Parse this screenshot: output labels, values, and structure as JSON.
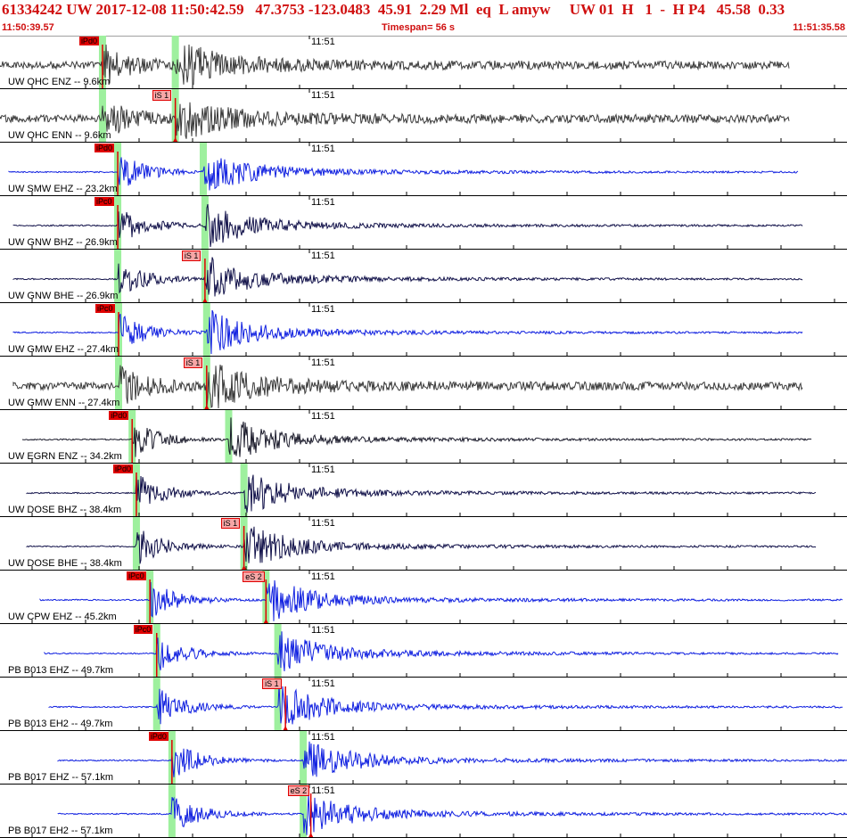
{
  "header": {
    "summary": "61334242 UW 2017-12-08 11:50:42.59   47.3753 -123.0483  45.91  2.29 Ml  eq  L amyw     UW 01  H   1  -  H P4   45.58  0.33",
    "start_time": "11:50:39.57",
    "timespan": "Timespan=  56 s",
    "end_time": "11:51:35.58"
  },
  "minute_mark": "11:51",
  "colors": {
    "header_text": "#d01010",
    "highlight": "#9ef09e",
    "pick": "#e00000",
    "pick_s_fill": "#f6a6a6"
  },
  "channels": [
    {
      "label": "UW OHC ENZ -- 9.6km",
      "color": "#3a3a3a",
      "hl_p": 0.121,
      "hl_s": 0.207,
      "picks": [
        {
          "type": "p",
          "label": "iPd0",
          "t": 0.121
        }
      ]
    },
    {
      "label": "UW OHC ENN -- 9.6km",
      "color": "#3a3a3a",
      "hl_p": 0.121,
      "hl_s": 0.207,
      "picks": [
        {
          "type": "s",
          "label": "iS 1",
          "t": 0.207
        }
      ]
    },
    {
      "label": "UW SMW EHZ -- 23.2km",
      "color": "#1020e0",
      "hl_p": 0.139,
      "hl_s": 0.24,
      "picks": [
        {
          "type": "p",
          "label": "iPd0",
          "t": 0.139
        }
      ]
    },
    {
      "label": "UW GNW BHZ -- 26.9km",
      "color": "#12124a",
      "hl_p": 0.139,
      "hl_s": 0.242,
      "picks": [
        {
          "type": "p",
          "label": "iPc0",
          "t": 0.139
        }
      ]
    },
    {
      "label": "UW GNW BHE -- 26.9km",
      "color": "#12124a",
      "hl_p": 0.139,
      "hl_s": 0.242,
      "picks": [
        {
          "type": "s",
          "label": "iS 1",
          "t": 0.242
        }
      ]
    },
    {
      "label": "UW GMW EHZ -- 27.4km",
      "color": "#1020e0",
      "hl_p": 0.14,
      "hl_s": 0.244,
      "picks": [
        {
          "type": "p",
          "label": "iPc0",
          "t": 0.14
        }
      ]
    },
    {
      "label": "UW GMW ENN -- 27.4km",
      "color": "#3a3a3a",
      "hl_p": 0.14,
      "hl_s": 0.244,
      "picks": [
        {
          "type": "s",
          "label": "iS 1",
          "t": 0.244
        }
      ]
    },
    {
      "label": "UW EGRN ENZ -- 34.2km",
      "color": "#1c1c2c",
      "hl_p": 0.156,
      "hl_s": 0.27,
      "picks": [
        {
          "type": "p",
          "label": "iPd0",
          "t": 0.156
        }
      ]
    },
    {
      "label": "UW DOSE BHZ -- 38.4km",
      "color": "#12124a",
      "hl_p": 0.161,
      "hl_s": 0.288,
      "picks": [
        {
          "type": "p",
          "label": "iPd0",
          "t": 0.161
        }
      ]
    },
    {
      "label": "UW DOSE BHE -- 38.4km",
      "color": "#12124a",
      "hl_p": 0.161,
      "hl_s": 0.288,
      "picks": [
        {
          "type": "s",
          "label": "iS 1",
          "t": 0.288
        }
      ]
    },
    {
      "label": "UW CPW EHZ -- 45.2km",
      "color": "#1020e0",
      "hl_p": 0.177,
      "hl_s": 0.314,
      "picks": [
        {
          "type": "p",
          "label": "iPc0",
          "t": 0.177
        },
        {
          "type": "s",
          "label": "eS 2",
          "t": 0.314
        }
      ]
    },
    {
      "label": "PB B013 EHZ -- 49.7km",
      "color": "#1020e0",
      "hl_p": 0.185,
      "hl_s": 0.328,
      "picks": [
        {
          "type": "p",
          "label": "iPc0",
          "t": 0.185
        }
      ]
    },
    {
      "label": "PB B013 EH2 -- 49.7km",
      "color": "#1020e0",
      "hl_p": 0.185,
      "hl_s": 0.328,
      "picks": [
        {
          "type": "s",
          "label": "iS 1",
          "t": 0.337
        }
      ]
    },
    {
      "label": "PB B017 EHZ -- 57.1km",
      "color": "#1020e0",
      "hl_p": 0.203,
      "hl_s": 0.358,
      "picks": [
        {
          "type": "p",
          "label": "iPd0",
          "t": 0.203
        }
      ]
    },
    {
      "label": "PB B017 EH2 -- 57.1km",
      "color": "#1020e0",
      "hl_p": 0.203,
      "hl_s": 0.358,
      "picks": [
        {
          "type": "s",
          "label": "eS 2",
          "t": 0.367
        }
      ]
    }
  ]
}
